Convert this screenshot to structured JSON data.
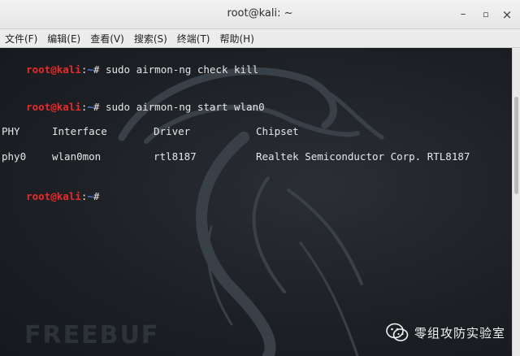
{
  "window": {
    "title": "root@kali: ~",
    "minimize": "–",
    "maximize": "▫",
    "close": "×"
  },
  "menu": [
    "文件(F)",
    "编辑(E)",
    "查看(V)",
    "搜索(S)",
    "终端(T)",
    "帮助(H)"
  ],
  "prompt": {
    "user": "root@kali",
    "sep": ":",
    "path": "~",
    "sym": "#"
  },
  "commands": [
    "sudo airmon-ng check kill",
    "sudo airmon-ng start wlan0"
  ],
  "table": {
    "headers": [
      "PHY",
      "Interface",
      "Driver",
      "Chipset"
    ],
    "row": [
      "phy0",
      "wlan0mon",
      "rtl8187",
      "Realtek Semiconductor Corp. RTL8187"
    ]
  },
  "watermark": {
    "freebuf": "FREEBUF",
    "brand": "零组攻防实验室"
  }
}
